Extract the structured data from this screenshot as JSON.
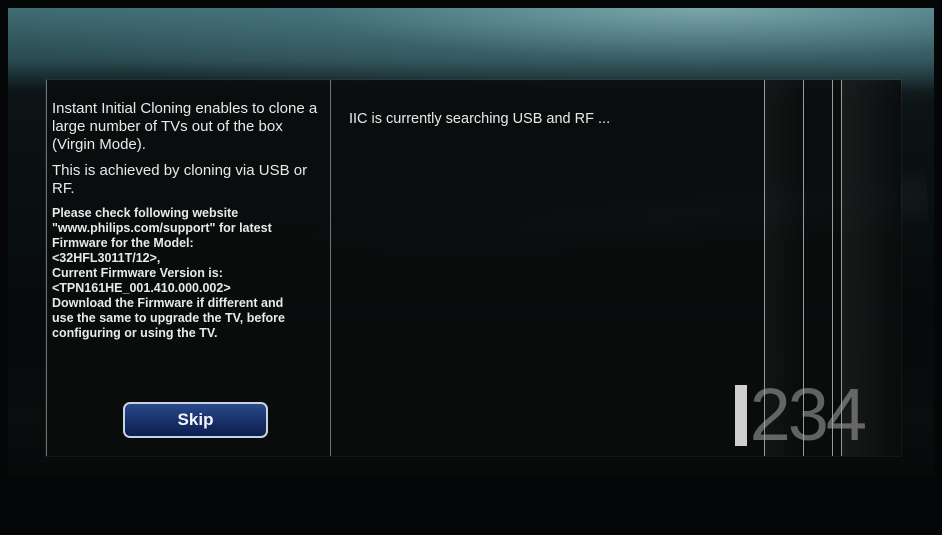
{
  "dialog": {
    "paragraphs": [
      "Instant Initial Cloning enables to clone a large number of TVs out of the box (Virgin Mode).",
      "This is achieved by cloning via USB or RF."
    ],
    "notice_lines": [
      "Please check following website",
      "\"www.philips.com/support\" for latest",
      "Firmware for the Model:",
      "<32HFL3011T/12>,",
      "Current Firmware Version is:",
      "<TPN161HE_001.410.000.002>",
      "Download the Firmware if different and",
      "use the same to upgrade the TV, before",
      "configuring or using the TV."
    ],
    "skip_label": "Skip",
    "status_text": "IIC is currently searching USB and RF ..."
  },
  "branding": {
    "number": "234"
  }
}
